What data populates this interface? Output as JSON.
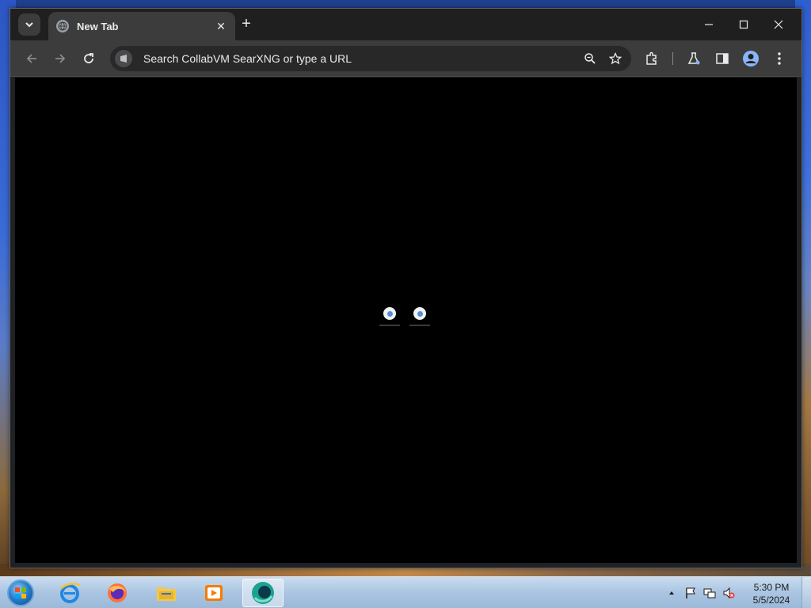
{
  "browser": {
    "tab": {
      "title": "New Tab"
    },
    "omnibox": {
      "placeholder": "Search CollabVM SearXNG or type a URL"
    }
  },
  "new_tab_page": {
    "shortcuts": [
      {
        "label": ""
      },
      {
        "label": ""
      }
    ]
  },
  "taskbar": {
    "apps": [
      "internet-explorer",
      "firefox",
      "file-explorer",
      "windows-media-player",
      "chrome"
    ],
    "clock": {
      "time": "5:30 PM",
      "date": "5/5/2024"
    }
  },
  "colors": {
    "titlebar": "#1f1f1f",
    "toolbar": "#3c3c3c",
    "content": "#000000",
    "taskbar": "#aac5e2"
  }
}
